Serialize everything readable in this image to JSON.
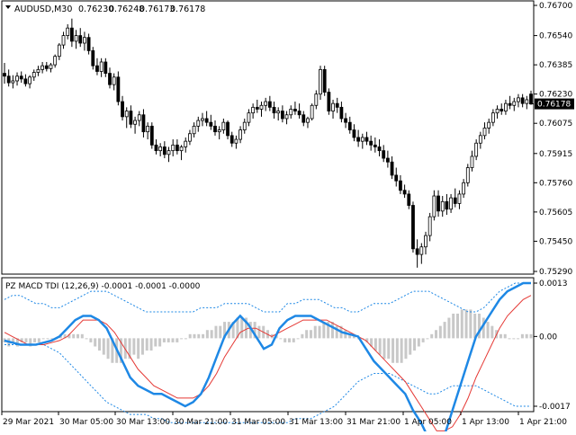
{
  "main_chart": {
    "symbol": "AUDUSD,M30",
    "open": "0.76230",
    "high": "0.76248",
    "low": "0.76173",
    "close": "0.76178",
    "price_ticks": [
      "0.76700",
      "0.76540",
      "0.76385",
      "0.76230",
      "0.76075",
      "0.75915",
      "0.75760",
      "0.75605",
      "0.75450",
      "0.75290"
    ],
    "current_price": "0.76178",
    "colors": {
      "bull": "#ffffff",
      "bear": "#000000",
      "price_box": "#000000"
    },
    "candles": [
      [
        0.7634,
        0.76395,
        0.76285,
        0.76325
      ],
      [
        0.76325,
        0.7636,
        0.7627,
        0.7629
      ],
      [
        0.7629,
        0.7633,
        0.7626,
        0.763
      ],
      [
        0.763,
        0.76345,
        0.76275,
        0.76325
      ],
      [
        0.76325,
        0.7635,
        0.7629,
        0.7631
      ],
      [
        0.7631,
        0.76335,
        0.7627,
        0.76285
      ],
      [
        0.76285,
        0.7633,
        0.7626,
        0.7632
      ],
      [
        0.7632,
        0.7636,
        0.763,
        0.76345
      ],
      [
        0.76345,
        0.7638,
        0.76325,
        0.7636
      ],
      [
        0.7636,
        0.764,
        0.7634,
        0.7638
      ],
      [
        0.7638,
        0.764,
        0.7635,
        0.76365
      ],
      [
        0.76365,
        0.76395,
        0.76345,
        0.76385
      ],
      [
        0.76385,
        0.7644,
        0.7637,
        0.7643
      ],
      [
        0.7643,
        0.765,
        0.7641,
        0.7649
      ],
      [
        0.7649,
        0.7656,
        0.7647,
        0.7654
      ],
      [
        0.7654,
        0.766,
        0.7652,
        0.7658
      ],
      [
        0.7658,
        0.7663,
        0.7648,
        0.7651
      ],
      [
        0.7651,
        0.7657,
        0.7647,
        0.7654
      ],
      [
        0.7654,
        0.7658,
        0.7648,
        0.765
      ],
      [
        0.765,
        0.7656,
        0.7646,
        0.7653
      ],
      [
        0.7653,
        0.7655,
        0.7644,
        0.7646
      ],
      [
        0.7646,
        0.7648,
        0.7636,
        0.7638
      ],
      [
        0.7638,
        0.7642,
        0.7633,
        0.7635
      ],
      [
        0.7635,
        0.7642,
        0.7632,
        0.764
      ],
      [
        0.764,
        0.7642,
        0.7632,
        0.7634
      ],
      [
        0.7634,
        0.7637,
        0.7626,
        0.7628
      ],
      [
        0.7628,
        0.7634,
        0.7625,
        0.7632
      ],
      [
        0.7632,
        0.7635,
        0.7617,
        0.7619
      ],
      [
        0.7619,
        0.7622,
        0.7609,
        0.7611
      ],
      [
        0.7611,
        0.7616,
        0.7605,
        0.7614
      ],
      [
        0.7614,
        0.7617,
        0.7605,
        0.7607
      ],
      [
        0.7607,
        0.7611,
        0.7602,
        0.7609
      ],
      [
        0.7609,
        0.7614,
        0.7606,
        0.7612
      ],
      [
        0.7612,
        0.7615,
        0.76,
        0.7603
      ],
      [
        0.7603,
        0.7608,
        0.7599,
        0.7606
      ],
      [
        0.7606,
        0.7608,
        0.7594,
        0.7596
      ],
      [
        0.7596,
        0.7599,
        0.7591,
        0.7593
      ],
      [
        0.7593,
        0.7597,
        0.759,
        0.7595
      ],
      [
        0.7595,
        0.7598,
        0.7589,
        0.7591
      ],
      [
        0.7591,
        0.7595,
        0.7587,
        0.7593
      ],
      [
        0.7593,
        0.7599,
        0.759,
        0.7596
      ],
      [
        0.7596,
        0.7599,
        0.7591,
        0.7593
      ],
      [
        0.7593,
        0.7596,
        0.7588,
        0.7595
      ],
      [
        0.7595,
        0.76,
        0.7592,
        0.7598
      ],
      [
        0.7598,
        0.7604,
        0.7596,
        0.7602
      ],
      [
        0.7602,
        0.7608,
        0.76,
        0.7606
      ],
      [
        0.7606,
        0.7611,
        0.7603,
        0.7609
      ],
      [
        0.7609,
        0.7613,
        0.7606,
        0.761
      ],
      [
        0.761,
        0.7614,
        0.7606,
        0.7608
      ],
      [
        0.7608,
        0.7612,
        0.7604,
        0.7606
      ],
      [
        0.7606,
        0.7609,
        0.7601,
        0.7603
      ],
      [
        0.7603,
        0.7606,
        0.7599,
        0.7604
      ],
      [
        0.7604,
        0.761,
        0.7602,
        0.7608
      ],
      [
        0.7608,
        0.7609,
        0.7599,
        0.7601
      ],
      [
        0.7601,
        0.7603,
        0.7595,
        0.7597
      ],
      [
        0.7597,
        0.7601,
        0.7594,
        0.7599
      ],
      [
        0.7599,
        0.7606,
        0.7597,
        0.7604
      ],
      [
        0.7604,
        0.761,
        0.7602,
        0.7608
      ],
      [
        0.7608,
        0.7615,
        0.7606,
        0.7613
      ],
      [
        0.7613,
        0.7618,
        0.761,
        0.7616
      ],
      [
        0.7616,
        0.762,
        0.7613,
        0.7615
      ],
      [
        0.7615,
        0.7619,
        0.7611,
        0.7617
      ],
      [
        0.7617,
        0.7621,
        0.7614,
        0.7619
      ],
      [
        0.7619,
        0.7622,
        0.7614,
        0.7616
      ],
      [
        0.7616,
        0.7619,
        0.761,
        0.7613
      ],
      [
        0.7613,
        0.7616,
        0.7609,
        0.7614
      ],
      [
        0.7614,
        0.7617,
        0.7608,
        0.761
      ],
      [
        0.761,
        0.7614,
        0.7607,
        0.7612
      ],
      [
        0.7612,
        0.7617,
        0.761,
        0.7615
      ],
      [
        0.7615,
        0.7619,
        0.7612,
        0.7614
      ],
      [
        0.7614,
        0.7618,
        0.761,
        0.7612
      ],
      [
        0.7612,
        0.7614,
        0.7606,
        0.7608
      ],
      [
        0.7608,
        0.7611,
        0.7605,
        0.761
      ],
      [
        0.761,
        0.7618,
        0.7609,
        0.7617
      ],
      [
        0.7617,
        0.7625,
        0.7615,
        0.7623
      ],
      [
        0.7623,
        0.7638,
        0.762,
        0.7636
      ],
      [
        0.7636,
        0.7638,
        0.7622,
        0.7624
      ],
      [
        0.7624,
        0.7626,
        0.7612,
        0.7614
      ],
      [
        0.7614,
        0.762,
        0.761,
        0.7618
      ],
      [
        0.7618,
        0.7621,
        0.7613,
        0.7616
      ],
      [
        0.7616,
        0.7619,
        0.7608,
        0.761
      ],
      [
        0.761,
        0.7613,
        0.7605,
        0.7608
      ],
      [
        0.7608,
        0.7611,
        0.7602,
        0.7604
      ],
      [
        0.7604,
        0.7607,
        0.7598,
        0.76
      ],
      [
        0.76,
        0.7604,
        0.7595,
        0.7598
      ],
      [
        0.7598,
        0.7602,
        0.7594,
        0.76
      ],
      [
        0.76,
        0.7603,
        0.7596,
        0.7598
      ],
      [
        0.7598,
        0.7601,
        0.7593,
        0.7596
      ],
      [
        0.7596,
        0.76,
        0.7592,
        0.7595
      ],
      [
        0.7595,
        0.7599,
        0.759,
        0.7593
      ],
      [
        0.7593,
        0.7596,
        0.7587,
        0.7589
      ],
      [
        0.7589,
        0.7593,
        0.7584,
        0.7587
      ],
      [
        0.7587,
        0.759,
        0.7578,
        0.758
      ],
      [
        0.758,
        0.7584,
        0.7574,
        0.7577
      ],
      [
        0.7577,
        0.758,
        0.757,
        0.7572
      ],
      [
        0.7572,
        0.7575,
        0.7568,
        0.757
      ],
      [
        0.757,
        0.7572,
        0.7562,
        0.7564
      ],
      [
        0.7564,
        0.7566,
        0.7539,
        0.7541
      ],
      [
        0.7541,
        0.7546,
        0.7531,
        0.7538
      ],
      [
        0.7538,
        0.7544,
        0.7533,
        0.7542
      ],
      [
        0.7542,
        0.755,
        0.7538,
        0.7548
      ],
      [
        0.7548,
        0.756,
        0.7545,
        0.7558
      ],
      [
        0.7558,
        0.7572,
        0.7556,
        0.7569
      ],
      [
        0.7569,
        0.7572,
        0.7558,
        0.7561
      ],
      [
        0.7561,
        0.7569,
        0.7558,
        0.7566
      ],
      [
        0.7566,
        0.757,
        0.7559,
        0.7562
      ],
      [
        0.7562,
        0.757,
        0.756,
        0.7568
      ],
      [
        0.7568,
        0.7573,
        0.7563,
        0.7565
      ],
      [
        0.7565,
        0.7572,
        0.7562,
        0.757
      ],
      [
        0.757,
        0.7578,
        0.7568,
        0.7576
      ],
      [
        0.7576,
        0.7586,
        0.7574,
        0.7584
      ],
      [
        0.7584,
        0.7593,
        0.7582,
        0.759
      ],
      [
        0.759,
        0.7599,
        0.7588,
        0.7597
      ],
      [
        0.7597,
        0.7603,
        0.7594,
        0.7601
      ],
      [
        0.7601,
        0.7608,
        0.7599,
        0.7605
      ],
      [
        0.7605,
        0.761,
        0.7602,
        0.7608
      ],
      [
        0.7608,
        0.7615,
        0.7606,
        0.7613
      ],
      [
        0.7613,
        0.7617,
        0.761,
        0.7615
      ],
      [
        0.7615,
        0.7618,
        0.7612,
        0.7614
      ],
      [
        0.7614,
        0.762,
        0.7612,
        0.7618
      ],
      [
        0.7618,
        0.7622,
        0.7615,
        0.7617
      ],
      [
        0.7617,
        0.7621,
        0.7614,
        0.7619
      ],
      [
        0.7619,
        0.7623,
        0.7616,
        0.7621
      ],
      [
        0.7621,
        0.7623,
        0.7616,
        0.7618
      ],
      [
        0.7618,
        0.7622,
        0.7615,
        0.762
      ],
      [
        0.7623,
        0.76248,
        0.76173,
        0.76178
      ]
    ]
  },
  "indicator": {
    "label": "PZ MACD TDI (12,26,9) -0.0001 -0.0001 -0.0000",
    "ticks": [
      "0.0013",
      "0.00",
      "-0.0017"
    ],
    "colors": {
      "macd": "#1e88e5",
      "signal": "#e53935",
      "bands": "#1e88e5",
      "histogram": "#c8c8c8"
    },
    "macd": [
      -0.0001,
      -0.00015,
      -0.0002,
      -0.0002,
      -0.0002,
      -0.00015,
      -0.0001,
      0.0,
      0.0002,
      0.0004,
      0.0005,
      0.0005,
      0.0004,
      0.0002,
      -0.0002,
      -0.0006,
      -0.001,
      -0.0012,
      -0.0013,
      -0.0014,
      -0.0014,
      -0.0015,
      -0.0016,
      -0.0017,
      -0.0016,
      -0.0014,
      -0.001,
      -0.0005,
      0.0,
      0.0003,
      0.0005,
      0.0003,
      0.0,
      -0.0003,
      -0.0002,
      0.0002,
      0.0004,
      0.0005,
      0.0005,
      0.0005,
      0.0004,
      0.0003,
      0.0002,
      0.0001,
      5e-05,
      0.0,
      -0.0003,
      -0.0006,
      -0.0008,
      -0.001,
      -0.0012,
      -0.0014,
      -0.0018,
      -0.0021,
      -0.0025,
      -0.0027,
      -0.0024,
      -0.0018,
      -0.0012,
      -0.0006,
      0.0,
      0.0003,
      0.0006,
      0.0009,
      0.0011,
      0.0012,
      0.0013,
      0.0013
    ],
    "signal": [
      0.0001,
      0.0,
      -0.0001,
      -0.0002,
      -0.0002,
      -0.0002,
      -0.00015,
      -0.0001,
      0.0,
      0.0002,
      0.0004,
      0.0004,
      0.0004,
      0.0003,
      0.0001,
      -0.0002,
      -0.0005,
      -0.0008,
      -0.001,
      -0.0012,
      -0.0013,
      -0.0014,
      -0.0015,
      -0.0015,
      -0.0015,
      -0.0014,
      -0.0012,
      -0.0009,
      -0.0005,
      -0.0002,
      0.0001,
      0.0002,
      0.0002,
      0.0001,
      0.0,
      0.0001,
      0.0002,
      0.0003,
      0.0004,
      0.0004,
      0.0004,
      0.0004,
      0.0003,
      0.0002,
      0.0001,
      0.0,
      -0.0001,
      -0.0003,
      -0.0005,
      -0.0007,
      -0.0009,
      -0.0011,
      -0.0014,
      -0.0017,
      -0.002,
      -0.0023,
      -0.0023,
      -0.0022,
      -0.0019,
      -0.0015,
      -0.001,
      -0.0006,
      -0.0002,
      0.0002,
      0.0005,
      0.0007,
      0.0009,
      0.001
    ],
    "upper_band": [
      0.0009,
      0.001,
      0.001,
      0.0009,
      0.0008,
      0.0008,
      0.0007,
      0.0007,
      0.0008,
      0.0009,
      0.001,
      0.0011,
      0.0011,
      0.0011,
      0.001,
      0.0009,
      0.0008,
      0.0007,
      0.0006,
      0.0006,
      0.0006,
      0.0006,
      0.0006,
      0.0006,
      0.0006,
      0.0007,
      0.0007,
      0.0007,
      0.0008,
      0.0008,
      0.0008,
      0.0008,
      0.0007,
      0.0006,
      0.0006,
      0.0006,
      0.0008,
      0.0008,
      0.0009,
      0.0009,
      0.0009,
      0.0008,
      0.0007,
      0.0007,
      0.0006,
      0.0006,
      0.0007,
      0.0008,
      0.0008,
      0.0008,
      0.0009,
      0.001,
      0.0011,
      0.0011,
      0.0011,
      0.001,
      0.0009,
      0.0008,
      0.0007,
      0.0006,
      0.0006,
      0.0007,
      0.0009,
      0.0011,
      0.0012,
      0.0013,
      0.0013,
      0.0013
    ],
    "lower_band": [
      -0.0002,
      -0.0002,
      -0.0002,
      -0.0002,
      -0.0002,
      -0.0002,
      -0.0003,
      -0.0004,
      -0.0006,
      -0.0008,
      -0.001,
      -0.0012,
      -0.0014,
      -0.0016,
      -0.0017,
      -0.0018,
      -0.0019,
      -0.0019,
      -0.0019,
      -0.002,
      -0.002,
      -0.0021,
      -0.0021,
      -0.0021,
      -0.0021,
      -0.0021,
      -0.0021,
      -0.0021,
      -0.0021,
      -0.0021,
      -0.0021,
      -0.0021,
      -0.0021,
      -0.0021,
      -0.0021,
      -0.0021,
      -0.0021,
      -0.002,
      -0.002,
      -0.002,
      -0.0019,
      -0.0018,
      -0.0017,
      -0.0015,
      -0.0013,
      -0.0011,
      -0.001,
      -0.0009,
      -0.0009,
      -0.0009,
      -0.001,
      -0.0011,
      -0.0012,
      -0.0013,
      -0.0014,
      -0.0014,
      -0.0013,
      -0.0012,
      -0.0012,
      -0.0012,
      -0.0012,
      -0.0013,
      -0.0014,
      -0.0015,
      -0.0016,
      -0.0017,
      -0.0017,
      -0.0017
    ],
    "histogram": [
      -0.0001,
      -0.0002,
      -0.0001,
      -0.0002,
      -0.0001,
      -0.0001,
      -0.0002,
      -0.0001,
      -0.0001,
      0.0,
      0.0,
      0.0,
      0.0,
      0.0001,
      0.0001,
      0.0001,
      0.0001,
      0.0001,
      0.0001,
      0.0,
      -0.0001,
      -0.0002,
      -0.0003,
      -0.0004,
      -0.0005,
      -0.0006,
      -0.0006,
      -0.0006,
      -0.0005,
      -0.0005,
      -0.0004,
      -0.0005,
      -0.0004,
      -0.0003,
      -0.0003,
      -0.0002,
      -0.0002,
      -0.0001,
      -0.0001,
      -0.0001,
      -0.0001,
      0.0,
      0.0,
      0.0001,
      0.0001,
      0.0001,
      0.0001,
      0.0002,
      0.0002,
      0.0003,
      0.0003,
      0.0004,
      0.0004,
      0.0004,
      0.0005,
      0.0005,
      0.0005,
      0.0004,
      0.0004,
      0.0003,
      0.0003,
      0.0002,
      0.0001,
      0.0001,
      0.0,
      -0.0001,
      -0.0001,
      -0.0001,
      0.0,
      0.0001,
      0.0002,
      0.0002,
      0.0003,
      0.0003,
      0.0004,
      0.0004,
      0.0004,
      0.0003,
      0.0003,
      0.0002,
      0.0001,
      0.0001,
      0.0,
      0.0,
      -0.0001,
      -0.0002,
      -0.0003,
      -0.0004,
      -0.0005,
      -0.0005,
      -0.0006,
      -0.0006,
      -0.0006,
      -0.0005,
      -0.0004,
      -0.0003,
      -0.0002,
      -0.0001,
      0.0,
      0.0001,
      0.0002,
      0.0003,
      0.0004,
      0.0005,
      0.0006,
      0.0006,
      0.0007,
      0.0007,
      0.0007,
      0.0006,
      0.0006,
      0.0005,
      0.0004,
      0.0003,
      0.0002,
      0.0001,
      0.0001,
      0.0,
      0.0,
      0.0,
      0.0001,
      0.0001,
      0.0001
    ]
  },
  "time_axis": [
    "29 Mar 2021",
    "30 Mar 05:00",
    "30 Mar 13:00",
    "30 Mar 21:00",
    "31 Mar 05:00",
    "31 Mar 13:00",
    "31 Mar 21:00",
    "1 Apr 05:00",
    "1 Apr 13:00",
    "1 Apr 21:00"
  ]
}
